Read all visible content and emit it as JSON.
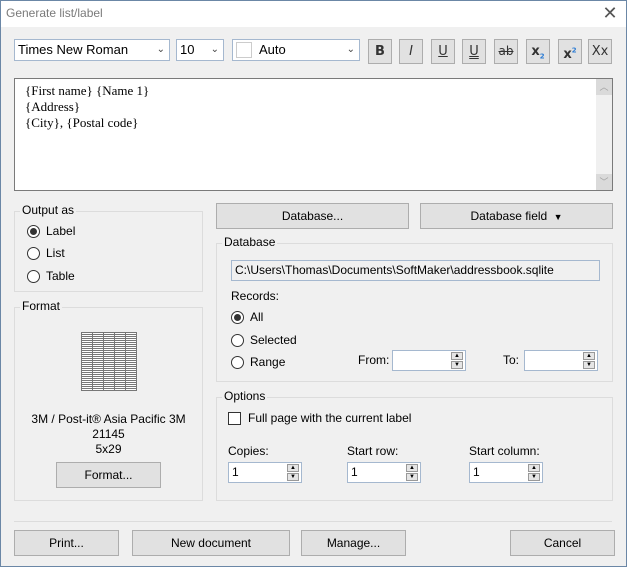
{
  "window": {
    "title": "Generate list/label",
    "close_icon": "close-icon"
  },
  "toolbar": {
    "font": "Times New Roman",
    "size": "10",
    "color": "Auto",
    "bold": "B",
    "italic": "I",
    "underline": "U",
    "double_underline": "U",
    "strikethrough": "ab",
    "subscript": "x",
    "subscript_mark": "2",
    "superscript": "x",
    "superscript_mark": "2",
    "caps": "Xx"
  },
  "editor": {
    "lines": [
      "{First name} {Name 1}",
      "{Address}",
      "{City}, {Postal code}"
    ]
  },
  "output_as": {
    "legend": "Output as",
    "options": [
      {
        "label": "Label",
        "selected": true
      },
      {
        "label": "List",
        "selected": false
      },
      {
        "label": "Table",
        "selected": false
      }
    ]
  },
  "format": {
    "legend": "Format",
    "line1": "3M / Post-it®  Asia Pacific 3M",
    "line2": "21145",
    "line3": "5x29",
    "button": "Format..."
  },
  "database_buttons": {
    "database": "Database...",
    "database_field": "Database field"
  },
  "database": {
    "legend": "Database",
    "path": "C:\\Users\\Thomas\\Documents\\SoftMaker\\addressbook.sqlite",
    "records_label": "Records:",
    "records": [
      {
        "label": "All",
        "selected": true
      },
      {
        "label": "Selected",
        "selected": false
      },
      {
        "label": "Range",
        "selected": false
      }
    ],
    "from_label": "From:",
    "from_value": "",
    "to_label": "To:",
    "to_value": ""
  },
  "options": {
    "legend": "Options",
    "full_page_label": "Full page with the current label",
    "full_page_checked": false,
    "copies_label": "Copies:",
    "copies_value": "1",
    "start_row_label": "Start row:",
    "start_row_value": "1",
    "start_column_label": "Start column:",
    "start_column_value": "1"
  },
  "footer": {
    "print": "Print...",
    "new_document": "New document",
    "manage": "Manage...",
    "cancel": "Cancel"
  }
}
